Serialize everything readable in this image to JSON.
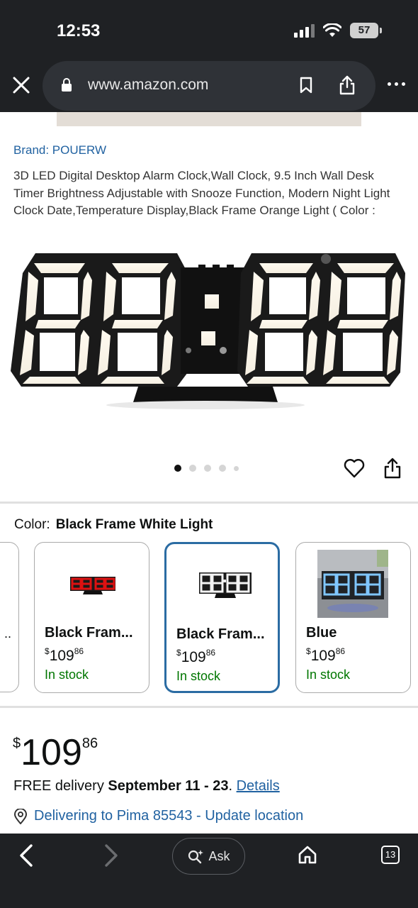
{
  "status_bar": {
    "time": "12:53",
    "battery": "57"
  },
  "browser": {
    "url": "www.amazon.com"
  },
  "product": {
    "brand": "Brand: POUERW",
    "title": "3D LED Digital Desktop Alarm Clock,Wall Clock, 9.5 Inch Wall Desk Timer Brightness Adjustable with Snooze Function, Modern Night Light Clock Date,Temperature Display,Black Frame Orange Light ( Color :",
    "carousel": {
      "count": 5,
      "active_index": 0
    }
  },
  "color_selector": {
    "label": "Color:",
    "selected": "Black Frame White Light",
    "partial_left_label": "..",
    "options": [
      {
        "name": "Black Fram...",
        "price_dollars": "109",
        "price_cents": "86",
        "currency": "$",
        "stock": "In stock",
        "selected": false
      },
      {
        "name": "Black Fram...",
        "price_dollars": "109",
        "price_cents": "86",
        "currency": "$",
        "stock": "In stock",
        "selected": true
      },
      {
        "name": "Blue",
        "price_dollars": "109",
        "price_cents": "86",
        "currency": "$",
        "stock": "In stock",
        "selected": false
      }
    ]
  },
  "price": {
    "currency": "$",
    "dollars": "109",
    "cents": "86"
  },
  "delivery": {
    "prefix": "FREE delivery",
    "dates": "September 11 - 23",
    "suffix": ".",
    "details_link": "Details"
  },
  "location": {
    "text": "Delivering to Pima 85543 - Update location"
  },
  "toolbar": {
    "ask_label": "Ask",
    "tab_count": "13"
  },
  "colors": {
    "link": "#2162a1",
    "in_stock": "#007600",
    "selected_border": "#2b6ca3",
    "chrome_bg": "#1f2124"
  }
}
